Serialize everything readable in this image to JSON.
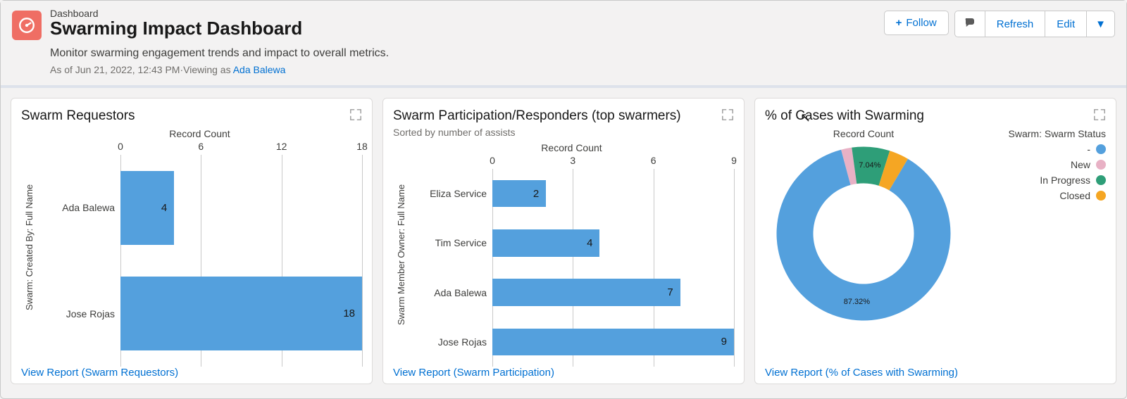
{
  "header": {
    "crumb": "Dashboard",
    "title": "Swarming Impact Dashboard",
    "description": "Monitor swarming engagement trends and impact to overall metrics.",
    "meta_prefix": "As of ",
    "meta_timestamp": "Jun 21, 2022, 12:43 PM",
    "meta_middle": "·Viewing as ",
    "meta_user": "Ada Balewa",
    "actions": {
      "follow": "Follow",
      "refresh": "Refresh",
      "edit": "Edit"
    }
  },
  "cards": {
    "requestors": {
      "title": "Swarm Requestors",
      "axis_title": "Record Count",
      "y_axis": "Swarm: Created By: Full Name",
      "footer": "View Report (Swarm Requestors)"
    },
    "responders": {
      "title": "Swarm Participation/Responders (top swarmers)",
      "subtitle": "Sorted by number of assists",
      "axis_title": "Record Count",
      "y_axis": "Swarm Member Owner: Full Name",
      "footer": "View Report (Swarm Participation)"
    },
    "donut": {
      "title": "% of Cases with Swarming",
      "axis_title": "Record Count",
      "legend_title": "Swarm: Swarm Status",
      "footer": "View Report (% of Cases with Swarming)"
    }
  },
  "chart_data": [
    {
      "id": "requestors",
      "type": "bar",
      "orientation": "horizontal",
      "xlabel": "Record Count",
      "ylabel": "Swarm: Created By: Full Name",
      "xlim": [
        0,
        18
      ],
      "xticks": [
        0,
        6,
        12,
        18
      ],
      "categories": [
        "Ada Balewa",
        "Jose Rojas"
      ],
      "values": [
        4,
        18
      ]
    },
    {
      "id": "responders",
      "type": "bar",
      "orientation": "horizontal",
      "xlabel": "Record Count",
      "ylabel": "Swarm Member Owner: Full Name",
      "xlim": [
        0,
        9
      ],
      "xticks": [
        0,
        3,
        6,
        9
      ],
      "categories": [
        "Eliza Service",
        "Tim Service",
        "Ada Balewa",
        "Jose Rojas"
      ],
      "values": [
        2,
        4,
        7,
        9
      ]
    },
    {
      "id": "cases",
      "type": "pie",
      "subtype": "donut",
      "title": "Record Count",
      "series": [
        {
          "name": "-",
          "value": 87.32,
          "label": "87.32%",
          "color": "#54a0dd"
        },
        {
          "name": "New",
          "value": 2.0,
          "label": "",
          "color": "#e8b1c5"
        },
        {
          "name": "In Progress",
          "value": 7.04,
          "label": "7.04%",
          "color": "#2e9e78"
        },
        {
          "name": "Closed",
          "value": 3.64,
          "label": "",
          "color": "#f5a623"
        }
      ],
      "legend": [
        "-",
        "New",
        "In Progress",
        "Closed"
      ]
    }
  ]
}
